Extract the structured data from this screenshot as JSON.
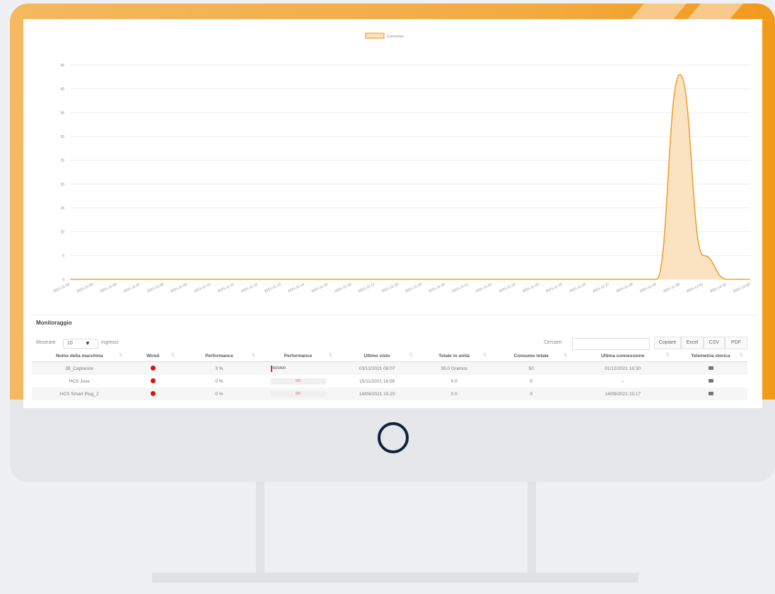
{
  "chart_data": {
    "type": "area",
    "legend": "Consumo",
    "legend_position": "top-center",
    "series_color": "#f0a030",
    "fill_color": "#fbe3c2",
    "grid": true,
    "ylim": [
      0,
      49
    ],
    "yticks": [
      "0",
      "5",
      "10",
      "15",
      "20",
      "25",
      "30",
      "35",
      "40",
      "45"
    ],
    "x": [
      "2021-11-04",
      "2021-11-05",
      "2021-11-06",
      "2021-11-07",
      "2021-11-08",
      "2021-11-09",
      "2021-11-10",
      "2021-11-11",
      "2021-11-12",
      "2021-11-13",
      "2021-11-14",
      "2021-11-15",
      "2021-11-16",
      "2021-11-17",
      "2021-11-18",
      "2021-11-19",
      "2021-11-20",
      "2021-11-21",
      "2021-11-22",
      "2021-11-23",
      "2021-11-24",
      "2021-11-25",
      "2021-11-26",
      "2021-11-27",
      "2021-11-28",
      "2021-11-29",
      "2021-11-30",
      "2021-12-01",
      "2021-12-02",
      "2021-12-03"
    ],
    "values": [
      0,
      0,
      0,
      0,
      0,
      0,
      0,
      0,
      0,
      0,
      0,
      0,
      0,
      0,
      0,
      0,
      0,
      0,
      0,
      0,
      0,
      0,
      0,
      0,
      0,
      0,
      43,
      5,
      0,
      0
    ]
  },
  "table": {
    "title": "Monitoraggio",
    "show_label": "Mostrare",
    "show_value": "10",
    "entries_label": "ingressi",
    "search_label": "Cercare:",
    "buttons": [
      "Copiare",
      "Excel",
      "CSV",
      "PDF"
    ],
    "headers": [
      "Nome della macchina",
      "Wired",
      "Performance",
      "Performance",
      "Ultimo visto",
      "Totale in unità",
      "Consumo totale",
      "Ultima connessione",
      "Telemetria storica"
    ],
    "rows": [
      {
        "name": "JB_Captación",
        "perf_pct": "3 %",
        "perf_bar": "50/2400",
        "last_seen": "03/12/2021 08:07",
        "total_units": "35.0 Gramos",
        "consumo": "50",
        "last_conn": "01/12/2021 16:30"
      },
      {
        "name": "HCS Jose",
        "perf_pct": "0 %",
        "perf_bar": "0/0",
        "last_seen": "15/11/2021 16:58",
        "total_units": "0.0",
        "consumo": "0",
        "last_conn": "--"
      },
      {
        "name": "HCS Smart Plug_2",
        "perf_pct": "0 %",
        "perf_bar": "0/0",
        "last_seen": "14/09/2021 15:23",
        "total_units": "0.0",
        "consumo": "0",
        "last_conn": "14/09/2021 15:17"
      }
    ]
  }
}
